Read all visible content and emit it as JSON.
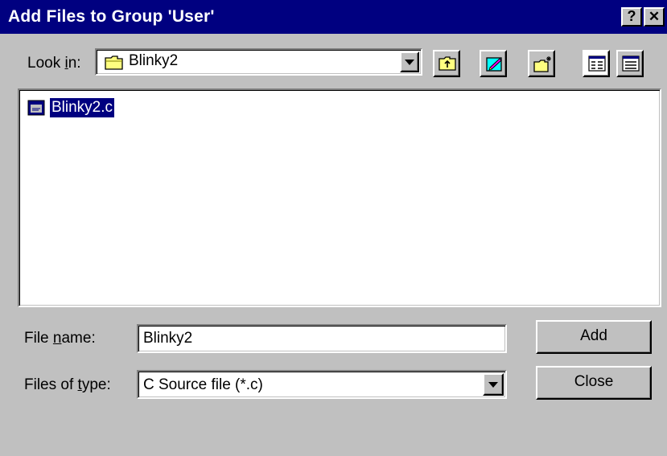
{
  "dialog": {
    "title": "Add Files to Group 'User'",
    "help_label": "?",
    "close_glyph": "✕"
  },
  "look_in": {
    "label_prefix": "Look ",
    "label_accel": "i",
    "label_suffix": "n:",
    "value": "Blinky2",
    "icon": "folder-icon"
  },
  "toolbar": {
    "buttons": [
      "up-one-level-icon",
      "desktop-icon",
      "new-folder-icon",
      "list-view-icon",
      "details-view-icon"
    ]
  },
  "file_list": {
    "items": [
      {
        "name": "Blinky2.c",
        "icon": "c-source-file-icon",
        "selected": true
      }
    ]
  },
  "file_name": {
    "label_prefix": "File ",
    "label_accel": "n",
    "label_suffix": "ame:",
    "value": "Blinky2"
  },
  "file_type": {
    "label_prefix": "Files of ",
    "label_accel": "t",
    "label_suffix": "ype:",
    "value": "C Source file (*.c)"
  },
  "buttons": {
    "add": "Add",
    "close": "Close"
  },
  "colors": {
    "titlebar": "#000080",
    "face": "#c0c0c0",
    "selection": "#000080"
  }
}
